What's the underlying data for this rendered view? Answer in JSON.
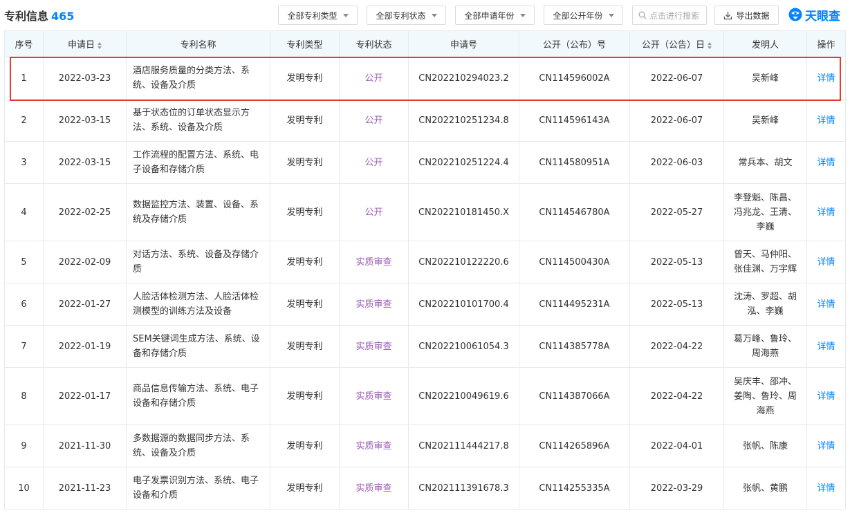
{
  "header": {
    "title": "专利信息",
    "count": "465"
  },
  "filters": {
    "type": "全部专利类型",
    "status": "全部专利状态",
    "apply_year": "全部申请年份",
    "publish_year": "全部公开年份"
  },
  "search": {
    "placeholder": "点击进行搜索"
  },
  "export": {
    "label": "导出数据"
  },
  "logo": {
    "text": "天眼查"
  },
  "table": {
    "columns": [
      "序号",
      "申请日",
      "专利名称",
      "专利类型",
      "专利状态",
      "申请号",
      "公开（公布）号",
      "公开（公告）日",
      "发明人",
      "操作"
    ],
    "rows": [
      {
        "no": "1",
        "apply_date": "2022-03-23",
        "name": "酒店服务质量的分类方法、系统、设备及介质",
        "type": "发明专利",
        "status": "公开",
        "app_no": "CN202210294023.2",
        "pub_no": "CN114596002A",
        "pub_date": "2022-06-07",
        "inventors": "吴新峰",
        "action": "详情"
      },
      {
        "no": "2",
        "apply_date": "2022-03-15",
        "name": "基于状态位的订单状态显示方法、系统、设备及介质",
        "type": "发明专利",
        "status": "公开",
        "app_no": "CN202210251234.8",
        "pub_no": "CN114596143A",
        "pub_date": "2022-06-07",
        "inventors": "吴新峰",
        "action": "详情"
      },
      {
        "no": "3",
        "apply_date": "2022-03-15",
        "name": "工作流程的配置方法、系统、电子设备和存储介质",
        "type": "发明专利",
        "status": "公开",
        "app_no": "CN202210251224.4",
        "pub_no": "CN114580951A",
        "pub_date": "2022-06-03",
        "inventors": "常兵本、胡文",
        "action": "详情"
      },
      {
        "no": "4",
        "apply_date": "2022-02-25",
        "name": "数据监控方法、装置、设备、系统及存储介质",
        "type": "发明专利",
        "status": "公开",
        "app_no": "CN202210181450.X",
        "pub_no": "CN114546780A",
        "pub_date": "2022-05-27",
        "inventors": "李登魁、陈昌、冯兆龙、王清、李巍",
        "action": "详情"
      },
      {
        "no": "5",
        "apply_date": "2022-02-09",
        "name": "对话方法、系统、设备及存储介质",
        "type": "发明专利",
        "status": "实质审查",
        "app_no": "CN202210122220.6",
        "pub_no": "CN114500430A",
        "pub_date": "2022-05-13",
        "inventors": "曾天、马仲阳、张佳渊、万宇辉",
        "action": "详情"
      },
      {
        "no": "6",
        "apply_date": "2022-01-27",
        "name": "人脸活体检测方法、人脸活体检测模型的训练方法及设备",
        "type": "发明专利",
        "status": "实质审查",
        "app_no": "CN202210101700.4",
        "pub_no": "CN114495231A",
        "pub_date": "2022-05-13",
        "inventors": "沈涛、罗超、胡泓、李巍",
        "action": "详情"
      },
      {
        "no": "7",
        "apply_date": "2022-01-19",
        "name": "SEM关键词生成方法、系统、设备和存储介质",
        "type": "发明专利",
        "status": "实质审查",
        "app_no": "CN202210061054.3",
        "pub_no": "CN114385778A",
        "pub_date": "2022-04-22",
        "inventors": "葛万峰、鲁玲、周海燕",
        "action": "详情"
      },
      {
        "no": "8",
        "apply_date": "2022-01-17",
        "name": "商品信息传输方法、系统、电子设备和存储介质",
        "type": "发明专利",
        "status": "实质审查",
        "app_no": "CN202210049619.6",
        "pub_no": "CN114387066A",
        "pub_date": "2022-04-22",
        "inventors": "吴庆丰、邵冲、姜陶、鲁玲、周海燕",
        "action": "详情"
      },
      {
        "no": "9",
        "apply_date": "2021-11-30",
        "name": "多数据源的数据同步方法、系统、设备及介质",
        "type": "发明专利",
        "status": "实质审查",
        "app_no": "CN202111444217.8",
        "pub_no": "CN114265896A",
        "pub_date": "2022-04-01",
        "inventors": "张帆、陈康",
        "action": "详情"
      },
      {
        "no": "10",
        "apply_date": "2021-11-23",
        "name": "电子发票识别方法、系统、电子设备和介质",
        "type": "发明专利",
        "status": "实质审查",
        "app_no": "CN202111391678.3",
        "pub_no": "CN114255335A",
        "pub_date": "2022-03-29",
        "inventors": "张帆、黄鹏",
        "action": "详情"
      }
    ]
  },
  "colors": {
    "accent": "#0084ff",
    "status_text": "#9b59b6",
    "highlight_border": "#e53935",
    "header_bg": "#f2f9fc"
  }
}
